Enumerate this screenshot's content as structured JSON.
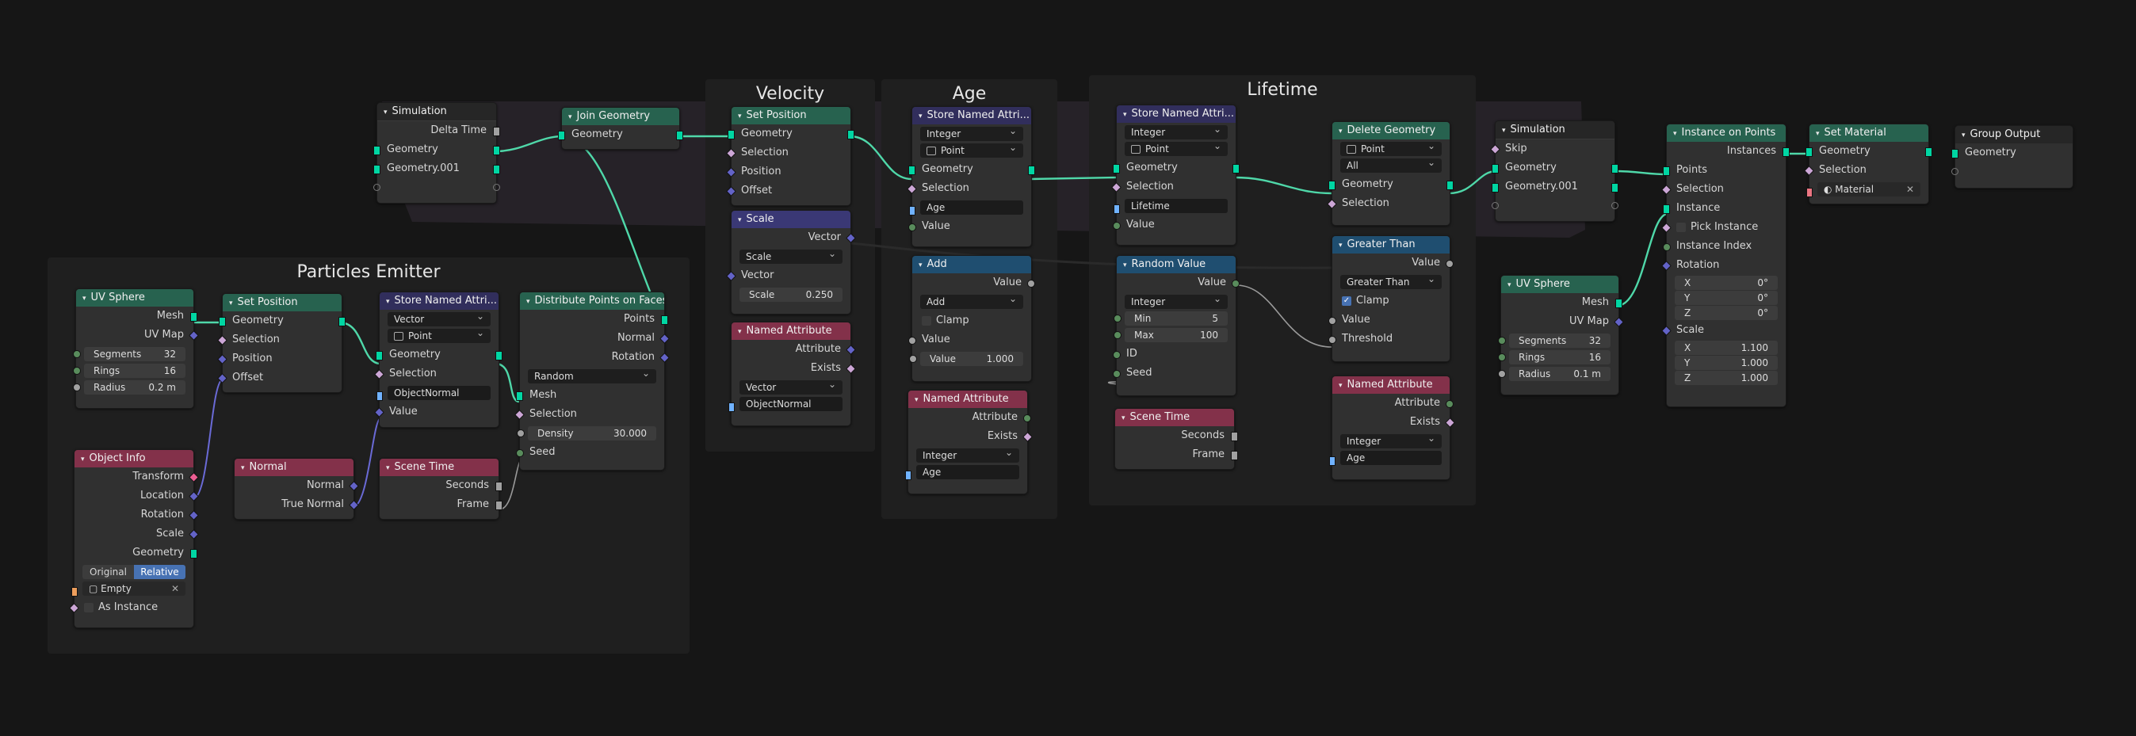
{
  "frames": {
    "velocity": "Velocity",
    "age": "Age",
    "lifetime": "Lifetime",
    "particles_emitter": "Particles Emitter"
  },
  "sim_in": {
    "title": "Simulation",
    "delta_time": "Delta Time",
    "geometry": "Geometry",
    "geometry001": "Geometry.001"
  },
  "join_geometry": {
    "title": "Join Geometry",
    "geometry": "Geometry"
  },
  "set_position_top": {
    "title": "Set Position",
    "geometry": "Geometry",
    "selection": "Selection",
    "position": "Position",
    "offset": "Offset"
  },
  "scale": {
    "title": "Scale",
    "vector": "Vector",
    "mode": "Scale",
    "vector_in": "Vector",
    "scale_label": "Scale",
    "scale_value": "0.250"
  },
  "named_attr_v": {
    "title": "Named Attribute",
    "attribute": "Attribute",
    "exists": "Exists",
    "type": "Vector",
    "name": "ObjectNormal"
  },
  "store_age": {
    "title": "Store Named Attri...",
    "type": "Integer",
    "domain": "Point",
    "geometry": "Geometry",
    "selection": "Selection",
    "name": "Age",
    "value": "Value"
  },
  "add": {
    "title": "Add",
    "value": "Value",
    "op": "Add",
    "clamp": "Clamp",
    "value_in": "Value",
    "value_label": "Value",
    "value_num": "1.000"
  },
  "named_attr_age": {
    "title": "Named Attribute",
    "attribute": "Attribute",
    "exists": "Exists",
    "type": "Integer",
    "name": "Age"
  },
  "store_life": {
    "title": "Store Named Attri...",
    "type": "Integer",
    "domain": "Point",
    "geometry": "Geometry",
    "selection": "Selection",
    "name": "Lifetime",
    "value": "Value"
  },
  "random_value": {
    "title": "Random Value",
    "value": "Value",
    "type": "Integer",
    "min_label": "Min",
    "min": "5",
    "max_label": "Max",
    "max": "100",
    "id": "ID",
    "seed": "Seed"
  },
  "scene_time_life": {
    "title": "Scene Time",
    "seconds": "Seconds",
    "frame": "Frame"
  },
  "delete_geometry": {
    "title": "Delete Geometry",
    "domain": "Point",
    "mode": "All",
    "geometry": "Geometry",
    "selection": "Selection"
  },
  "greater_than": {
    "title": "Greater Than",
    "value": "Value",
    "op": "Greater Than",
    "clamp": "Clamp",
    "value_in": "Value",
    "threshold": "Threshold"
  },
  "named_attr_life": {
    "title": "Named Attribute",
    "attribute": "Attribute",
    "exists": "Exists",
    "type": "Integer",
    "name": "Age"
  },
  "sim_out": {
    "title": "Simulation",
    "skip": "Skip",
    "geometry": "Geometry",
    "geometry001": "Geometry.001"
  },
  "instance_on_points": {
    "title": "Instance on Points",
    "instances": "Instances",
    "points": "Points",
    "selection": "Selection",
    "instance": "Instance",
    "pick_instance": "Pick Instance",
    "instance_index": "Instance Index",
    "rotation": "Rotation",
    "rx": "0°",
    "ry": "0°",
    "rz": "0°",
    "scale": "Scale",
    "sx": "1.100",
    "sy": "1.000",
    "sz": "1.000"
  },
  "set_material": {
    "title": "Set Material",
    "geometry": "Geometry",
    "selection": "Selection",
    "material": "Material"
  },
  "group_output": {
    "title": "Group Output",
    "geometry": "Geometry"
  },
  "uv_sphere_r": {
    "title": "UV Sphere",
    "mesh": "Mesh",
    "uv_map": "UV Map",
    "segments_label": "Segments",
    "segments": "32",
    "rings_label": "Rings",
    "rings": "16",
    "radius_label": "Radius",
    "radius": "0.1 m"
  },
  "uv_sphere_l": {
    "title": "UV Sphere",
    "mesh": "Mesh",
    "uv_map": "UV Map",
    "segments_label": "Segments",
    "segments": "32",
    "rings_label": "Rings",
    "rings": "16",
    "radius_label": "Radius",
    "radius": "0.2 m"
  },
  "set_position_emit": {
    "title": "Set Position",
    "geometry": "Geometry",
    "selection": "Selection",
    "position": "Position",
    "offset": "Offset"
  },
  "store_normal": {
    "title": "Store Named Attri...",
    "type": "Vector",
    "domain": "Point",
    "geometry": "Geometry",
    "selection": "Selection",
    "name": "ObjectNormal",
    "value": "Value"
  },
  "distribute": {
    "title": "Distribute Points on Faces",
    "points": "Points",
    "normal": "Normal",
    "rotation": "Rotation",
    "mode": "Random",
    "mesh": "Mesh",
    "selection": "Selection",
    "density_label": "Density",
    "density": "30.000",
    "seed": "Seed"
  },
  "object_info": {
    "title": "Object Info",
    "transform": "Transform",
    "location": "Location",
    "rotation": "Rotation",
    "scale": "Scale",
    "geometry": "Geometry",
    "original": "Original",
    "relative": "Relative",
    "object": "Empty",
    "as_instance": "As Instance"
  },
  "normal": {
    "title": "Normal",
    "normal": "Normal",
    "true_normal": "True Normal"
  },
  "scene_time_emit": {
    "title": "Scene Time",
    "seconds": "Seconds",
    "frame": "Frame"
  }
}
